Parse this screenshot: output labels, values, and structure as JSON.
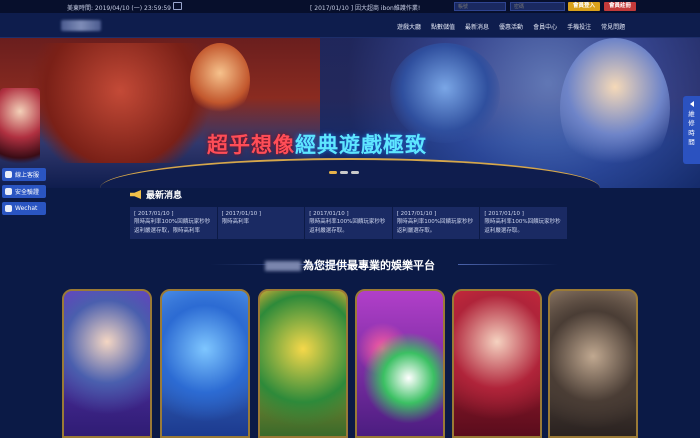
{
  "topbar": {
    "time_text": "美東時間: 2019/04/10 (一) 23:59:59",
    "marquee_text": "[ 2017/01/10 ] 因大超商 ibon維護作業!",
    "account_placeholder": "帳號",
    "password_placeholder": "密碼",
    "password_hint": "忘記密碼?",
    "login_label": "會員登入",
    "register_label": "會員註冊"
  },
  "nav": {
    "items": [
      "遊戲大廳",
      "點數儲值",
      "最新消息",
      "優惠活動",
      "會員中心",
      "手機投注",
      "常見問題"
    ]
  },
  "banner": {
    "slogan_red": "超乎想像",
    "slogan_cyan": "經典遊戲極致",
    "slides": 3,
    "active_slide": 1
  },
  "news": {
    "heading": "最新消息",
    "items": [
      {
        "date": "[ 2017/01/10 ]",
        "text": "限時高利率100%回饋玩家秒秒返利嚴選存取，限時高利率"
      },
      {
        "date": "[ 2017/01/10 ]",
        "text": "限時高利率"
      },
      {
        "date": "[ 2017/01/10 ]",
        "text": "限時高利率100%回饋玩家秒秒返利嚴選存取。"
      },
      {
        "date": "[ 2017/01/10 ]",
        "text": "限時高利率100%回饋玩家秒秒返利嚴選存取。"
      },
      {
        "date": "[ 2017/01/10 ]",
        "text": "限時高利率100%回饋玩家秒秒返利嚴選存取。"
      }
    ]
  },
  "section": {
    "title": "為您提供最專業的娛樂平台"
  },
  "sidebar_left": {
    "buttons": [
      "線上客服",
      "安全驗證",
      "Wechat"
    ]
  },
  "sidebar_right": {
    "label": "維修時間"
  },
  "colors": {
    "bg": "#0b1a46",
    "accent_gold": "#d9a11b",
    "accent_red": "#c33a3a",
    "slogan_red": "#ff4d57",
    "slogan_cyan": "#5ee6ff",
    "side_blue": "#2a55c2"
  }
}
